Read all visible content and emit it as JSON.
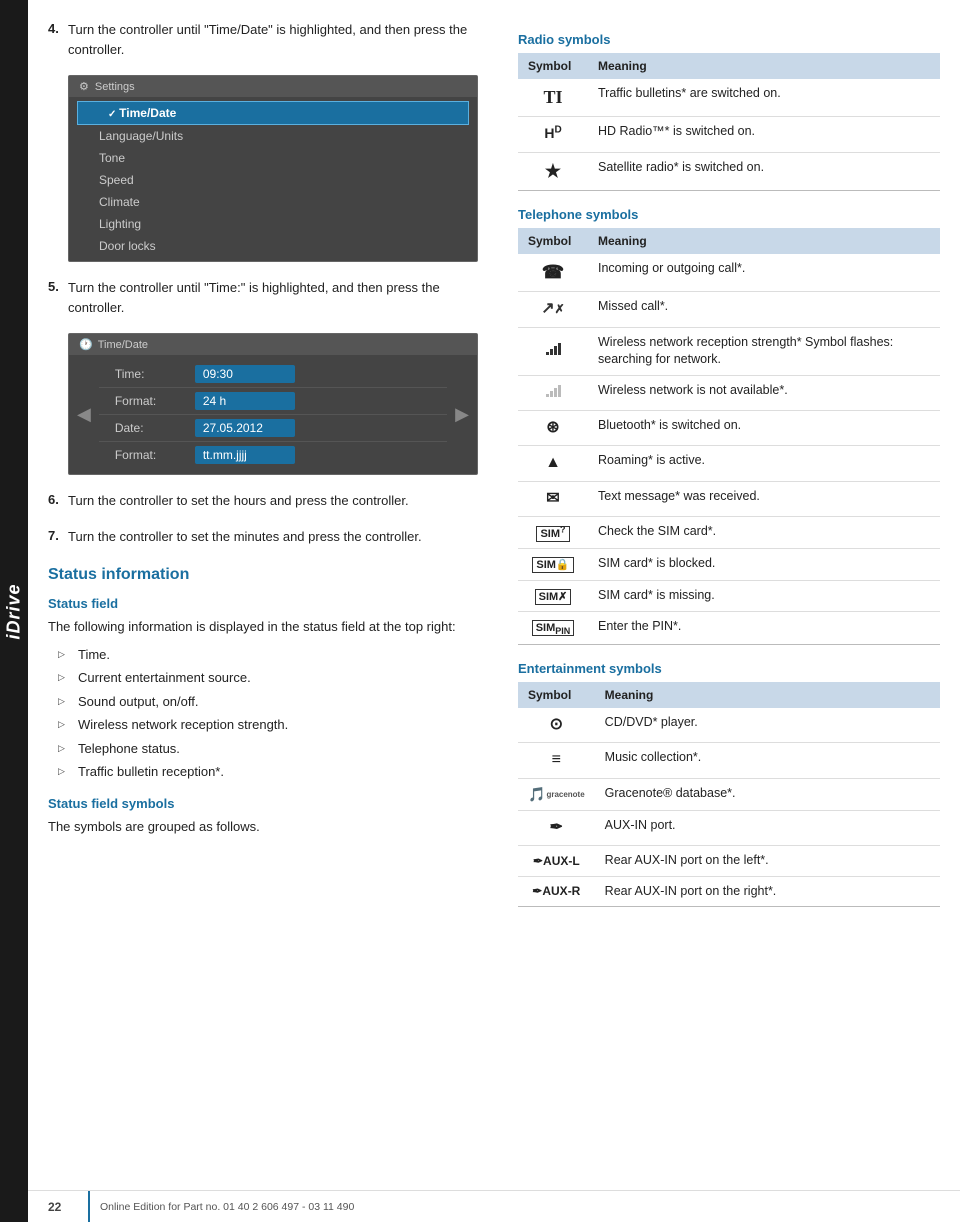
{
  "side_tab": {
    "label": "iDrive"
  },
  "left_col": {
    "steps": [
      {
        "num": "4.",
        "text": "Turn the controller until \"Time/Date\" is highlighted, and then press the controller."
      },
      {
        "num": "5.",
        "text": "Turn the controller until \"Time:\" is highlighted, and then press the controller."
      },
      {
        "num": "6.",
        "text": "Turn the controller to set the hours and press the controller."
      },
      {
        "num": "7.",
        "text": "Turn the controller to set the minutes and press the controller."
      }
    ],
    "screenshot1": {
      "title": "Settings",
      "items": [
        "Time/Date",
        "Language/Units",
        "Tone",
        "Speed",
        "Climate",
        "Lighting",
        "Door locks"
      ]
    },
    "screenshot2": {
      "title": "Time/Date",
      "rows": [
        {
          "label": "Time:",
          "value": "09:30"
        },
        {
          "label": "Format:",
          "value": "24 h"
        },
        {
          "label": "Date:",
          "value": "27.05.2012"
        },
        {
          "label": "Format:",
          "value": "tt.mm.jjjj"
        }
      ]
    },
    "status_section": {
      "heading": "Status information",
      "status_field_heading": "Status field",
      "status_field_text": "The following information is displayed in the status field at the top right:",
      "bullet_items": [
        "Time.",
        "Current entertainment source.",
        "Sound output, on/off.",
        "Wireless network reception strength.",
        "Telephone status.",
        "Traffic bulletin reception*."
      ],
      "status_field_symbols_heading": "Status field symbols",
      "status_field_symbols_text": "The symbols are grouped as follows."
    }
  },
  "right_col": {
    "radio_heading": "Radio symbols",
    "radio_table": {
      "col1": "Symbol",
      "col2": "Meaning",
      "rows": [
        {
          "symbol": "TI",
          "meaning": "Traffic bulletins* are switched on."
        },
        {
          "symbol": "HD",
          "meaning": "HD Radio™* is switched on."
        },
        {
          "symbol": "★",
          "meaning": "Satellite radio* is switched on."
        }
      ]
    },
    "telephone_heading": "Telephone symbols",
    "telephone_table": {
      "col1": "Symbol",
      "col2": "Meaning",
      "rows": [
        {
          "symbol": "☎",
          "meaning": "Incoming or outgoing call*."
        },
        {
          "symbol": "↗",
          "meaning": "Missed call*."
        },
        {
          "symbol": "▪▪▪",
          "meaning": "Wireless network reception strength* Symbol flashes: searching for network."
        },
        {
          "symbol": "▫▫▫",
          "meaning": "Wireless network is not available*."
        },
        {
          "symbol": "⊛",
          "meaning": "Bluetooth* is switched on."
        },
        {
          "symbol": "▲",
          "meaning": "Roaming* is active."
        },
        {
          "symbol": "✉",
          "meaning": "Text message* was received."
        },
        {
          "symbol": "🖬",
          "meaning": "Check the SIM card*."
        },
        {
          "symbol": "🖬🔒",
          "meaning": "SIM card* is blocked."
        },
        {
          "symbol": "🖬✗",
          "meaning": "SIM card* is missing."
        },
        {
          "symbol": "🖬#",
          "meaning": "Enter the PIN*."
        }
      ]
    },
    "entertainment_heading": "Entertainment symbols",
    "entertainment_table": {
      "col1": "Symbol",
      "col2": "Meaning",
      "rows": [
        {
          "symbol": "⊙",
          "meaning": "CD/DVD* player."
        },
        {
          "symbol": "≡",
          "meaning": "Music collection*."
        },
        {
          "symbol": "G",
          "meaning": "Gracenote® database*."
        },
        {
          "symbol": "✒",
          "meaning": "AUX-IN port."
        },
        {
          "symbol": "✒AUX-L",
          "meaning": "Rear AUX-IN port on the left*."
        },
        {
          "symbol": "✒AUX-R",
          "meaning": "Rear AUX-IN port on the right*."
        }
      ]
    }
  },
  "footer": {
    "page_num": "22",
    "text": "Online Edition for Part no. 01 40 2 606 497 - 03 11 490"
  }
}
